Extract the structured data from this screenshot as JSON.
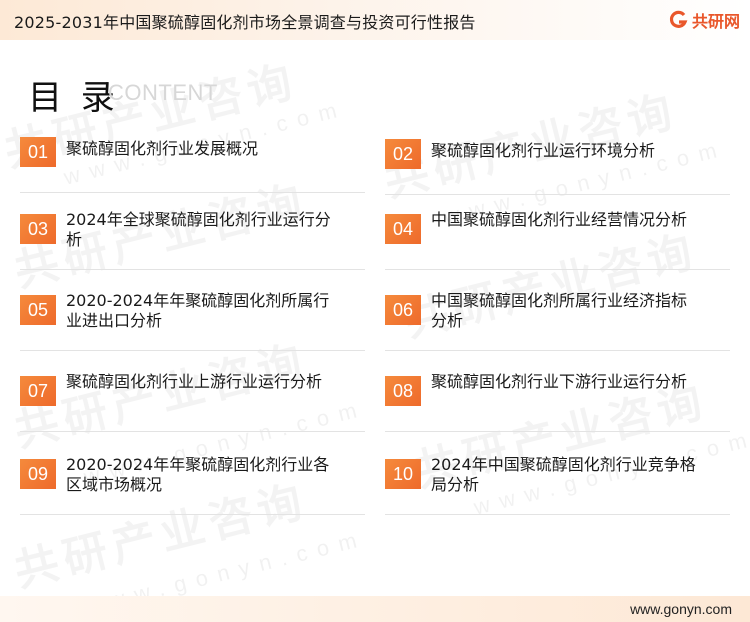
{
  "header": {
    "title": "2025-2031年中国聚硫醇固化剂市场全景调查与投资可行性报告",
    "logo_text": "共研网"
  },
  "toc": {
    "title": "目 录",
    "subtitle": "CONTENT",
    "items": [
      {
        "num": "01",
        "text": "聚硫醇固化剂行业发展概况"
      },
      {
        "num": "02",
        "text": "聚硫醇固化剂行业运行环境分析"
      },
      {
        "num": "03",
        "text": "2024年全球聚硫醇固化剂行业运行分析"
      },
      {
        "num": "04",
        "text": "中国聚硫醇固化剂行业经营情况分析"
      },
      {
        "num": "05",
        "text": "2020-2024年年聚硫醇固化剂所属行业进出口分析"
      },
      {
        "num": "06",
        "text": "中国聚硫醇固化剂所属行业经济指标分析"
      },
      {
        "num": "07",
        "text": "聚硫醇固化剂行业上游行业运行分析"
      },
      {
        "num": "08",
        "text": "聚硫醇固化剂行业下游行业运行分析"
      },
      {
        "num": "09",
        "text": "2020-2024年年聚硫醇固化剂行业各区域市场概况"
      },
      {
        "num": "10",
        "text": "2024年中国聚硫醇固化剂行业竞争格局分析"
      }
    ]
  },
  "watermark": {
    "text": "共研产业咨询",
    "url": "www.gonyn.com"
  },
  "footer": {
    "url": "www.gonyn.com"
  },
  "colors": {
    "accent": "#ee6a2b",
    "logo": "#e9572b"
  }
}
